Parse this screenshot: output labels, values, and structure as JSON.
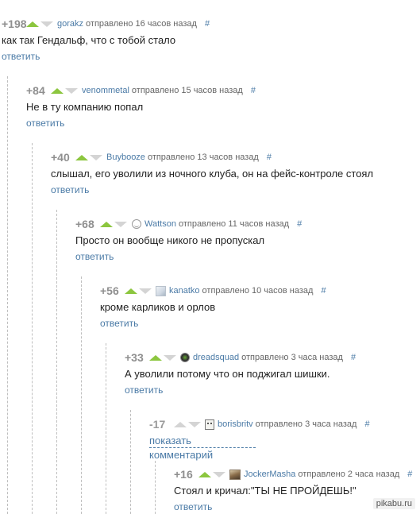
{
  "comments": [
    {
      "rating": "+198",
      "author": "gorakz",
      "sent": "отправлено 16 часов назад",
      "hash": "#",
      "text": "как так Гендальф, что с тобой стало",
      "reply": "ответить"
    },
    {
      "rating": "+84",
      "author": "venommetal",
      "sent": "отправлено 15 часов назад",
      "hash": "#",
      "text": "Не в ту компанию попал",
      "reply": "ответить"
    },
    {
      "rating": "+40",
      "author": "Buybooze",
      "sent": "отправлено 13 часов назад",
      "hash": "#",
      "text": "слышал, его уволили из ночного клуба, он на фейс-контроле стоял",
      "reply": "ответить"
    },
    {
      "rating": "+68",
      "author": "Wattson",
      "sent": "отправлено 11 часов назад",
      "hash": "#",
      "text": "Просто он вообще никого не пропускал",
      "reply": "ответить",
      "avatar_icon": "smiley-icon"
    },
    {
      "rating": "+56",
      "author": "kanatko",
      "sent": "отправлено 10 часов назад",
      "hash": "#",
      "text": "кроме карликов и орлов",
      "reply": "ответить",
      "avatar_icon": "image-placeholder-icon"
    },
    {
      "rating": "+33",
      "author": "dreadsquad",
      "sent": "отправлено 3 часа назад",
      "hash": "#",
      "text": "А уволили потому что он поджигал шишки.",
      "reply": "ответить",
      "avatar_icon": "circle-avatar"
    },
    {
      "rating": "-17",
      "author": "borisbritv",
      "sent": "отправлено 3 часа назад",
      "hash": "#",
      "show_comment": "показать комментарий",
      "avatar_icon": "robot-avatar"
    },
    {
      "rating": "+16",
      "author": "JockerMasha",
      "sent": "отправлено 2 часа назад",
      "hash": "#",
      "text": "Стоял и кричал:\"ТЫ НЕ ПРОЙДЕШЬ!\"",
      "reply": "ответить",
      "avatar_icon": "photo-avatar"
    }
  ],
  "watermark": "pikabu.ru",
  "colors": {
    "upvote": "#8cc63f",
    "link": "#4a7aa6",
    "rating": "#8f8f8f"
  }
}
